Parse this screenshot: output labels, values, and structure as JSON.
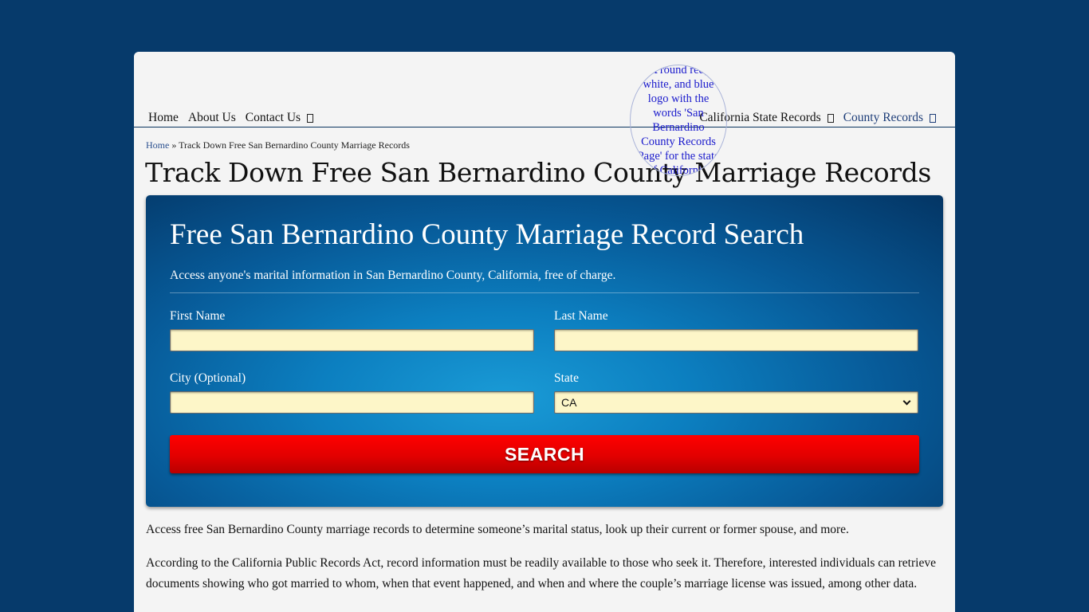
{
  "logo": {
    "alt_text": "A round red, white, and blue logo with the words 'San Bernardino County Records Page' for the state of California."
  },
  "nav": {
    "left": [
      "Home",
      "About Us",
      "Contact Us"
    ],
    "right_state": "California State Records",
    "right_county": "County Records"
  },
  "breadcrumb": {
    "home": "Home",
    "separator": " » ",
    "current": "Track Down Free San Bernardino County Marriage Records"
  },
  "page_title": "Track Down Free San Bernardino County Marriage Records",
  "search": {
    "title": "Free San Bernardino County Marriage Record Search",
    "subtitle": "Access anyone's marital information in San Bernardino County, California, free of charge.",
    "first_name_label": "First Name",
    "first_name_value": "",
    "last_name_label": "Last Name",
    "last_name_value": "",
    "city_label": "City (Optional)",
    "city_value": "",
    "state_label": "State",
    "state_value": "CA",
    "button": "SEARCH"
  },
  "paragraphs": [
    "Access free San Bernardino County marriage records to determine someone’s marital status, look up their current or former spouse, and more.",
    "According to the California Public Records Act, record information must be readily available to those who seek it. Therefore, interested individuals can retrieve documents showing who got married to whom, when that event happened, and when and where the couple’s marriage license was issued, among other data."
  ]
}
